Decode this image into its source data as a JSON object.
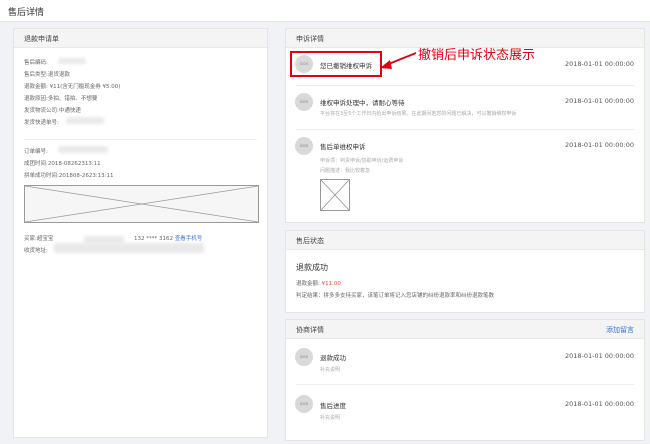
{
  "page": {
    "title": "售后详情"
  },
  "refund": {
    "header": "退款申请单",
    "lines": {
      "code": "售后编码:",
      "type": "售后类型:退货退款",
      "amount_prefix": "退款金额: ¥",
      "amount_rest": "11(含无门槛现金券 ¥5.00)",
      "reason": "退款原因:多拍、错拍、不想要",
      "carrier": "发货物流公司:中通快递",
      "tracking": "发货快递单号:"
    },
    "order": {
      "order_no": "订单编号:",
      "created": "成团时间:2018-08262313:11",
      "group_success": "拼单成功时间:201808-2623:13:11"
    },
    "buyer": {
      "label": "买家:超宝宝",
      "phone": "132 **** 3162",
      "phone_link": "查看手机号",
      "address": "收货地址:"
    }
  },
  "appeal": {
    "header": "申诉详情",
    "items": [
      {
        "avatar": "icon",
        "title": "您已撤销维权申诉",
        "time": "2018-01-01 00:00:00"
      },
      {
        "avatar": "icon",
        "title": "维权申诉处理中，请耐心等待",
        "sub": "平台将在3至5个工作日内给出申诉结果。在此期间若您的问题已解决，可以撤销维权申诉",
        "time": "2018-01-01 00:00:00"
      },
      {
        "avatar": "icon",
        "title": "售后单维权申诉",
        "sub1": "申诉项：判责申诉/协助申诉/运费申诉",
        "sub2": "问题描述：我比较着急",
        "time": "2018-01-01 00:00:00"
      }
    ]
  },
  "annotation": {
    "text": "撤销后申诉状态展示",
    "color": "#e60012"
  },
  "status": {
    "header": "售后状态",
    "title": "退款成功",
    "amount_label": "退款金额:",
    "amount_value": "¥11.00",
    "result": "判定结果：拼多多支持买家，该笔订单将记入您店铺的纠纷退款率和纠纷退款笔数"
  },
  "negotiation": {
    "header": "协商详情",
    "add_link": "添加留言",
    "items": [
      {
        "avatar": "icon",
        "title": "退款成功",
        "sub": "补充说明",
        "time": "2018-01-01 00:00:00"
      },
      {
        "avatar": "icon",
        "title": "售后进度",
        "sub": "补充说明",
        "time": "2018-01-01 00:00:00"
      }
    ]
  },
  "colors": {
    "accent_red": "#e74c3c",
    "link_blue": "#3b73d8",
    "annotation_red": "#e60012"
  }
}
